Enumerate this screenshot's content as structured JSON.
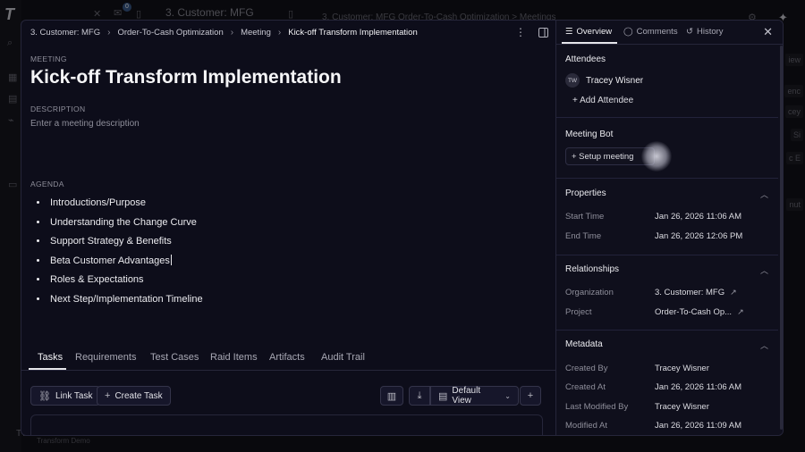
{
  "background": {
    "app_title": "3. Customer: MFG",
    "crumbs": "3. Customer: MFG    Order-To-Cash Optimization  >  Meetings",
    "notification_count": "0",
    "footer_user": "TW",
    "footer_workspace": "Transform Demo",
    "right_cells": [
      "iew",
      "enc",
      "cey",
      "Si",
      "c E",
      "nut"
    ]
  },
  "breadcrumb": {
    "items": [
      "3. Customer: MFG",
      "Order-To-Cash Optimization",
      "Meeting"
    ],
    "current": "Kick-off Transform Implementation"
  },
  "meeting": {
    "type_label": "MEETING",
    "title": "Kick-off Transform Implementation",
    "description_label": "DESCRIPTION",
    "description_placeholder": "Enter a meeting description",
    "agenda_label": "AGENDA",
    "agenda": [
      "Introductions/Purpose",
      "Understanding the Change Curve",
      "Support Strategy & Benefits",
      "Beta Customer Advantages",
      "Roles & Expectations",
      "Next Step/Implementation Timeline"
    ]
  },
  "tabs": [
    "Tasks",
    "Requirements",
    "Test Cases",
    "Raid Items",
    "Artifacts",
    "Audit Trail"
  ],
  "actions": {
    "link_task": "Link Task",
    "create_task": "Create Task",
    "view": "Default View"
  },
  "panel": {
    "tabs": {
      "overview": "Overview",
      "comments": "Comments",
      "history": "History"
    },
    "attendees": {
      "title": "Attendees",
      "people": [
        {
          "initials": "TW",
          "name": "Tracey Wisner"
        }
      ],
      "add": "Add Attendee"
    },
    "bot": {
      "title": "Meeting Bot",
      "button": "+ Setup meeting"
    },
    "properties": {
      "title": "Properties",
      "start_label": "Start Time",
      "start": "Jan 26, 2026 11:06 AM",
      "end_label": "End Time",
      "end": "Jan 26, 2026 12:06 PM"
    },
    "relationships": {
      "title": "Relationships",
      "org_label": "Organization",
      "org": "3. Customer: MFG",
      "project_label": "Project",
      "project": "Order-To-Cash Op..."
    },
    "metadata": {
      "title": "Metadata",
      "created_by_label": "Created By",
      "created_by": "Tracey Wisner",
      "created_at_label": "Created At",
      "created_at": "Jan 26, 2026 11:06 AM",
      "modified_by_label": "Last Modified By",
      "modified_by": "Tracey Wisner",
      "modified_at_label": "Modified At",
      "modified_at": "Jan 26, 2026 11:09 AM"
    }
  }
}
